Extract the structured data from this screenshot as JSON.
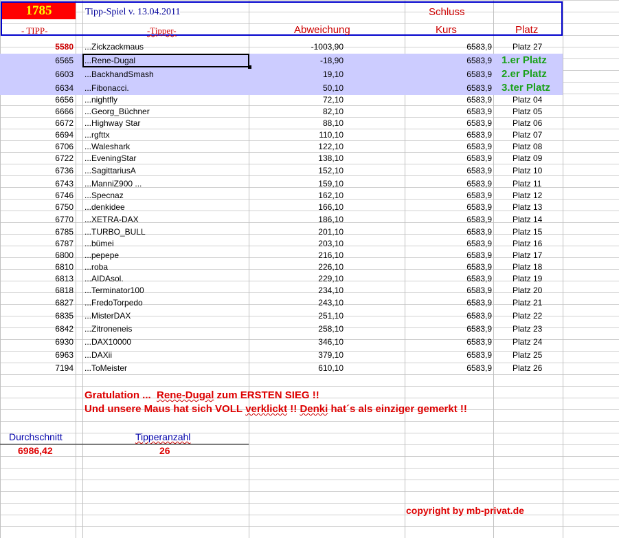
{
  "header": {
    "game_number": "1785",
    "title": "Tipp-Spiel v. 13.04.2011",
    "schluss": "Schluss",
    "col_tipp": "- TIPP-",
    "col_tipper": "-Tipper-",
    "col_abweichung": "Abweichung",
    "col_kurs": "Kurs",
    "col_platz": "Platz"
  },
  "rows": [
    {
      "tipp": "5580",
      "tipper": "...Zickzackmaus",
      "abw": "-1003,90",
      "kurs": "6583,9",
      "platz": "Platz 27"
    },
    {
      "tipp": "6565",
      "tipper": "...Rene-Dugal",
      "abw": "-18,90",
      "kurs": "6583,9",
      "platz": "1.er Platz"
    },
    {
      "tipp": "6603",
      "tipper": "...BackhandSmash",
      "abw": "19,10",
      "kurs": "6583,9",
      "platz": "2.er Platz"
    },
    {
      "tipp": "6634",
      "tipper": "...Fibonacci.",
      "abw": "50,10",
      "kurs": "6583,9",
      "platz": "3.ter Platz"
    },
    {
      "tipp": "6656",
      "tipper": "...nightfly",
      "abw": "72,10",
      "kurs": "6583,9",
      "platz": "Platz 04"
    },
    {
      "tipp": "6666",
      "tipper": "...Georg_Büchner",
      "abw": "82,10",
      "kurs": "6583,9",
      "platz": "Platz 05"
    },
    {
      "tipp": "6672",
      "tipper": "...Highway Star",
      "abw": "88,10",
      "kurs": "6583,9",
      "platz": "Platz 06"
    },
    {
      "tipp": "6694",
      "tipper": "...rgfttx",
      "abw": "110,10",
      "kurs": "6583,9",
      "platz": "Platz 07"
    },
    {
      "tipp": "6706",
      "tipper": "...Waleshark",
      "abw": "122,10",
      "kurs": "6583,9",
      "platz": "Platz 08"
    },
    {
      "tipp": "6722",
      "tipper": "...EveningStar",
      "abw": "138,10",
      "kurs": "6583,9",
      "platz": "Platz 09"
    },
    {
      "tipp": "6736",
      "tipper": "...SagittariusA",
      "abw": "152,10",
      "kurs": "6583,9",
      "platz": "Platz 10"
    },
    {
      "tipp": "6743",
      "tipper": "...ManniZ900 ...",
      "abw": "159,10",
      "kurs": "6583,9",
      "platz": "Platz 11"
    },
    {
      "tipp": "6746",
      "tipper": "...Specnaz",
      "abw": "162,10",
      "kurs": "6583,9",
      "platz": "Platz 12"
    },
    {
      "tipp": "6750",
      "tipper": "...denkidee",
      "abw": "166,10",
      "kurs": "6583,9",
      "platz": "Platz 13"
    },
    {
      "tipp": "6770",
      "tipper": "...XETRA-DAX",
      "abw": "186,10",
      "kurs": "6583,9",
      "platz": "Platz 14"
    },
    {
      "tipp": "6785",
      "tipper": "...TURBO_BULL",
      "abw": "201,10",
      "kurs": "6583,9",
      "platz": "Platz 15"
    },
    {
      "tipp": "6787",
      "tipper": "...bümei",
      "abw": "203,10",
      "kurs": "6583,9",
      "platz": "Platz 16"
    },
    {
      "tipp": "6800",
      "tipper": "...pepepe",
      "abw": "216,10",
      "kurs": "6583,9",
      "platz": "Platz 17"
    },
    {
      "tipp": "6810",
      "tipper": "...roba",
      "abw": "226,10",
      "kurs": "6583,9",
      "platz": "Platz 18"
    },
    {
      "tipp": "6813",
      "tipper": "...AIDAsol.",
      "abw": "229,10",
      "kurs": "6583,9",
      "platz": "Platz 19"
    },
    {
      "tipp": "6818",
      "tipper": "...Terminator100",
      "abw": "234,10",
      "kurs": "6583,9",
      "platz": "Platz 20"
    },
    {
      "tipp": "6827",
      "tipper": "...FredoTorpedo",
      "abw": "243,10",
      "kurs": "6583,9",
      "platz": "Platz 21"
    },
    {
      "tipp": "6835",
      "tipper": "...MisterDAX",
      "abw": "251,10",
      "kurs": "6583,9",
      "platz": "Platz 22"
    },
    {
      "tipp": "6842",
      "tipper": "...Zitroneneis",
      "abw": "258,10",
      "kurs": "6583,9",
      "platz": "Platz 23"
    },
    {
      "tipp": "6930",
      "tipper": "...DAX10000",
      "abw": "346,10",
      "kurs": "6583,9",
      "platz": "Platz 24"
    },
    {
      "tipp": "6963",
      "tipper": "...DAXii",
      "abw": "379,10",
      "kurs": "6583,9",
      "platz": "Platz 25"
    },
    {
      "tipp": "7194",
      "tipper": "...ToMeister",
      "abw": "610,10",
      "kurs": "6583,9",
      "platz": "Platz 26"
    }
  ],
  "notes": {
    "line1_a": "Gratulation ...",
    "line1_b": "Rene-Dugal",
    "line1_c": "zum   ERSTEN SIEG !!",
    "line2_a": "Und unsere Maus hat sich VOLL",
    "line2_b": "verklickt",
    "line2_c": "!!",
    "line2_d": "Denki",
    "line2_e": "hat´s als einziger gemerkt !!"
  },
  "summary": {
    "avg_label": "Durchschnitt",
    "avg_value": "6986,42",
    "count_label": "Tipperanzahl",
    "count_value": "26"
  },
  "footer": {
    "copyright": "copyright by mb-privat.de"
  },
  "colors": {
    "title_bg": "#ff0000",
    "title_fg": "#ffff00",
    "header_border": "#0000cc",
    "highlight_row": "#ccccff",
    "place_green": "#1aa11a",
    "note_red": "#dd0000"
  }
}
